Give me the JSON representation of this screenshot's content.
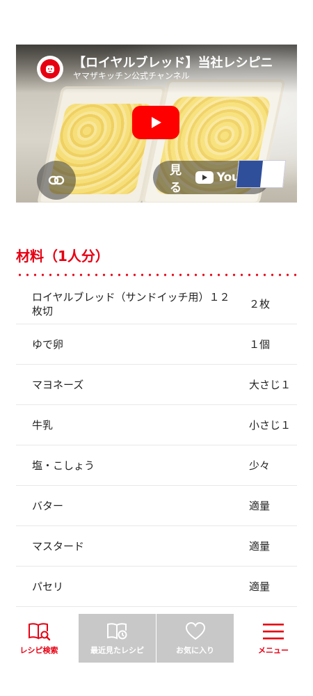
{
  "video": {
    "title": "【ロイヤルブレッド】当社レシピニ",
    "channel": "ヤマザキッチン公式チャンネル",
    "watch_label": "見る",
    "youtube_label": "YouTube",
    "logo_icon": "bread-face-icon",
    "play_icon": "play-icon",
    "link_icon": "link-icon"
  },
  "ingredients": {
    "title": "材料（1人分）",
    "items": [
      {
        "name": "ロイヤルブレッド（サンドイッチ用）１２枚切",
        "amount": "２枚"
      },
      {
        "name": "ゆで卵",
        "amount": "１個"
      },
      {
        "name": "マヨネーズ",
        "amount": "大さじ１"
      },
      {
        "name": "牛乳",
        "amount": "小さじ１"
      },
      {
        "name": "塩・こしょう",
        "amount": "少々"
      },
      {
        "name": "バター",
        "amount": "適量"
      },
      {
        "name": "マスタード",
        "amount": "適量"
      },
      {
        "name": "パセリ",
        "amount": "適量"
      }
    ]
  },
  "nav": {
    "recipe_search": "レシピ検索",
    "recently_viewed": "最近見たレシピ",
    "favorites": "お気に入り",
    "menu": "メニュー"
  },
  "colors": {
    "accent": "#e60012",
    "nav_inactive_bg": "#c8c8c8"
  }
}
